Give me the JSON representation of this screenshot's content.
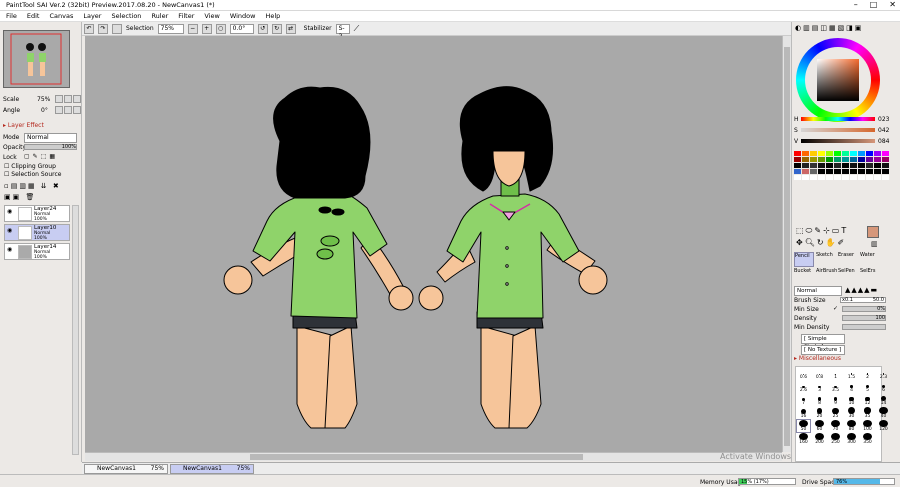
{
  "window": {
    "title": "PaintTool SAI Ver.2 (32bit) Preview.2017.08.20 - NewCanvas1 (*)",
    "controls": [
      "–",
      "□",
      "✕"
    ]
  },
  "menu": [
    "File",
    "Edit",
    "Canvas",
    "Layer",
    "Selection",
    "Ruler",
    "Filter",
    "View",
    "Window",
    "Help"
  ],
  "toolbar": {
    "selection_label": "Selection",
    "zoom": "75%",
    "angle": "0.0°",
    "stabilizer_label": "Stabilizer",
    "stabilizer": "S-2"
  },
  "navigator": {
    "scale_label": "Scale",
    "scale": "75%",
    "angle_label": "Angle",
    "angle": "0°"
  },
  "layer_panel": {
    "effect_label": "Layer Effect",
    "mode_label": "Mode",
    "mode": "Normal",
    "opacity_label": "Opacity",
    "opacity": "100%",
    "lock_label": "Lock",
    "clipping_label": "Clipping Group",
    "selection_source_label": "Selection Source",
    "layers": [
      {
        "name": "Layer24",
        "mode": "Normal",
        "opacity": "100%"
      },
      {
        "name": "Layer10",
        "mode": "Normal",
        "opacity": "100%"
      },
      {
        "name": "Layer14",
        "mode": "Normal",
        "opacity": "100%"
      }
    ]
  },
  "color": {
    "h_label": "H",
    "h": "023",
    "s_label": "S",
    "s": "042",
    "v_label": "V",
    "v": "084",
    "current": "#d6977a"
  },
  "tools": {
    "row1": [
      "Pencil",
      "Sketch",
      "Eraser",
      "Water"
    ],
    "row2": [
      "Bucket",
      "AirBrush",
      "SelPen",
      "SelErs"
    ],
    "blend": "Normal",
    "brush_size_label": "Brush Size",
    "brush_size_mult": "x0.1",
    "brush_size": "50.0",
    "min_size_label": "Min Size",
    "min_size": "0%",
    "density_label": "Density",
    "density": "100",
    "min_density_label": "Min Density",
    "shape": "[ Simple Circle ]",
    "texture": "[ No Texture ]",
    "misc_label": "Miscellaneous"
  },
  "brush_sizes": [
    "0.6",
    "0.8",
    "1",
    "1.5",
    "2",
    "2.3",
    "2.6",
    "3",
    "3.5",
    "4",
    "5",
    "6",
    "7",
    "8",
    "9",
    "10",
    "12",
    "14",
    "16",
    "20",
    "25",
    "30",
    "35",
    "40",
    "50",
    "60",
    "70",
    "80",
    "100",
    "120",
    "160",
    "200",
    "250",
    "300",
    "350"
  ],
  "canvas_tabs": [
    {
      "name": "NewCanvas1",
      "zoom": "75%"
    },
    {
      "name": "NewCanvas1",
      "zoom": "75%"
    }
  ],
  "status": {
    "memory_label": "Memory Usage",
    "memory": "15% (17%)",
    "drive_label": "Drive Space",
    "drive": "76%",
    "watermark": "Activate Windows"
  }
}
